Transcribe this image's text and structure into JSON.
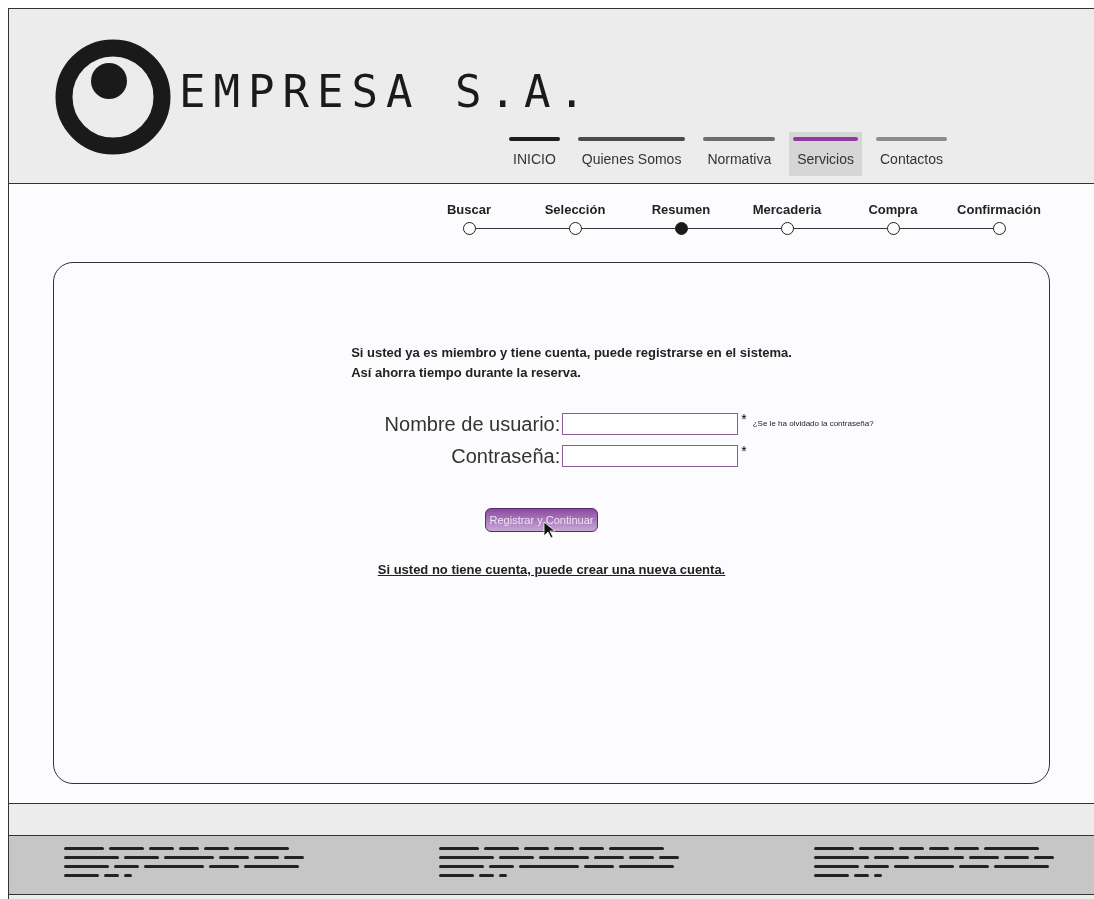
{
  "logo": {
    "text": "EMPRESA S.A."
  },
  "nav": [
    {
      "label": "INICIO",
      "color": "#1e1e1e",
      "selected": false
    },
    {
      "label": "Quienes Somos",
      "color": "#4a4a4a",
      "selected": false
    },
    {
      "label": "Normativa",
      "color": "#6c6c6c",
      "selected": false
    },
    {
      "label": "Servicios",
      "color": "#8e3a9e",
      "selected": true
    },
    {
      "label": "Contactos",
      "color": "#8c8c8c",
      "selected": false
    }
  ],
  "steps": [
    {
      "label": "Buscar",
      "selected": false
    },
    {
      "label": "Selección",
      "selected": false
    },
    {
      "label": "Resumen",
      "selected": true
    },
    {
      "label": "Mercaderia",
      "selected": false
    },
    {
      "label": "Compra",
      "selected": false
    },
    {
      "label": "Confirmación",
      "selected": false
    }
  ],
  "intro": [
    "Si usted ya es miembro y tiene cuenta, puede registrarse en el sistema.",
    "Así ahorra tiempo durante la reserva."
  ],
  "fields": [
    {
      "label": "Nombre de usuario:",
      "required_mark": "*",
      "hint": "¿Se le ha olvidado la contraseña?"
    },
    {
      "label": "Contraseña:",
      "required_mark": "*"
    }
  ],
  "submit": "Registrar y Continuar",
  "create_link": "Si usted no tiene cuenta, puede crear una nueva cuenta."
}
